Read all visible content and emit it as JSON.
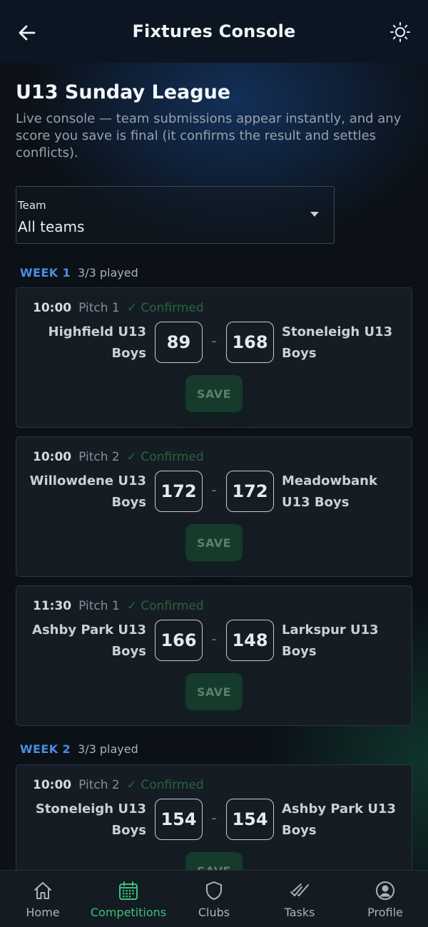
{
  "app_bar": {
    "title": "Fixtures Console",
    "back_icon": "arrow-left-icon",
    "theme_icon": "sun-icon"
  },
  "league": {
    "title": "U13 Sunday League",
    "description": "Live console — team submissions appear instantly, and any score you save is final (it confirms the result and settles conflicts)."
  },
  "team_filter": {
    "label": "Team",
    "value": "All teams"
  },
  "weeks": [
    {
      "label": "WEEK 1",
      "played": "3/3 played",
      "fixtures": [
        {
          "time": "10:00",
          "pitch": "Pitch 1",
          "status": "✓ Confirmed",
          "home_team": "Highfield U13 Boys",
          "home_score": "89",
          "away_team": "Stoneleigh U13 Boys",
          "away_score": "168",
          "save_label": "SAVE"
        },
        {
          "time": "10:00",
          "pitch": "Pitch 2",
          "status": "✓ Confirmed",
          "home_team": "Willowdene U13 Boys",
          "home_score": "172",
          "away_team": "Meadowbank U13 Boys",
          "away_score": "172",
          "save_label": "SAVE"
        },
        {
          "time": "11:30",
          "pitch": "Pitch 1",
          "status": "✓ Confirmed",
          "home_team": "Ashby Park U13 Boys",
          "home_score": "166",
          "away_team": "Larkspur U13 Boys",
          "away_score": "148",
          "save_label": "SAVE"
        }
      ]
    },
    {
      "label": "WEEK 2",
      "played": "3/3 played",
      "fixtures": [
        {
          "time": "10:00",
          "pitch": "Pitch 2",
          "status": "✓ Confirmed",
          "home_team": "Stoneleigh U13 Boys",
          "home_score": "154",
          "away_team": "Ashby Park U13 Boys",
          "away_score": "154",
          "save_label": "SAVE"
        }
      ]
    }
  ],
  "score_separator": "-",
  "bottom_nav": [
    {
      "label": "Home",
      "icon": "home-icon",
      "active": false
    },
    {
      "label": "Competitions",
      "icon": "calendar-icon",
      "active": true
    },
    {
      "label": "Clubs",
      "icon": "shield-icon",
      "active": false
    },
    {
      "label": "Tasks",
      "icon": "double-check-icon",
      "active": false
    },
    {
      "label": "Profile",
      "icon": "user-circle-icon",
      "active": false
    }
  ],
  "colors": {
    "accent_green": "#3cc27c",
    "week_blue": "#4a8fe0",
    "confirmed_green": "#27653f"
  }
}
